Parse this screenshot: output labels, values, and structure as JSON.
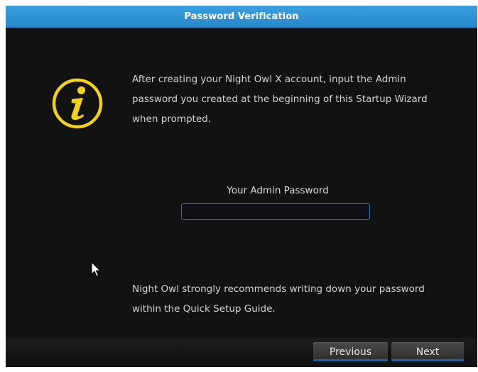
{
  "dialog": {
    "title": "Password Verification",
    "icon": "info-icon",
    "message": "After creating your Night Owl X account, input the Admin\npassword you created at the beginning of this Startup Wizard\nwhen prompted.",
    "password": {
      "label": "Your Admin Password",
      "value": ""
    },
    "note": " Night Owl strongly recommends writing down your password\nwithin the Quick Setup Guide.",
    "buttons": {
      "previous": "Previous",
      "next": "Next"
    }
  },
  "colors": {
    "titlebar": "#2a86cc",
    "background": "#121212",
    "icon": "#f2d31b",
    "input_border": "#2d6fc8"
  }
}
